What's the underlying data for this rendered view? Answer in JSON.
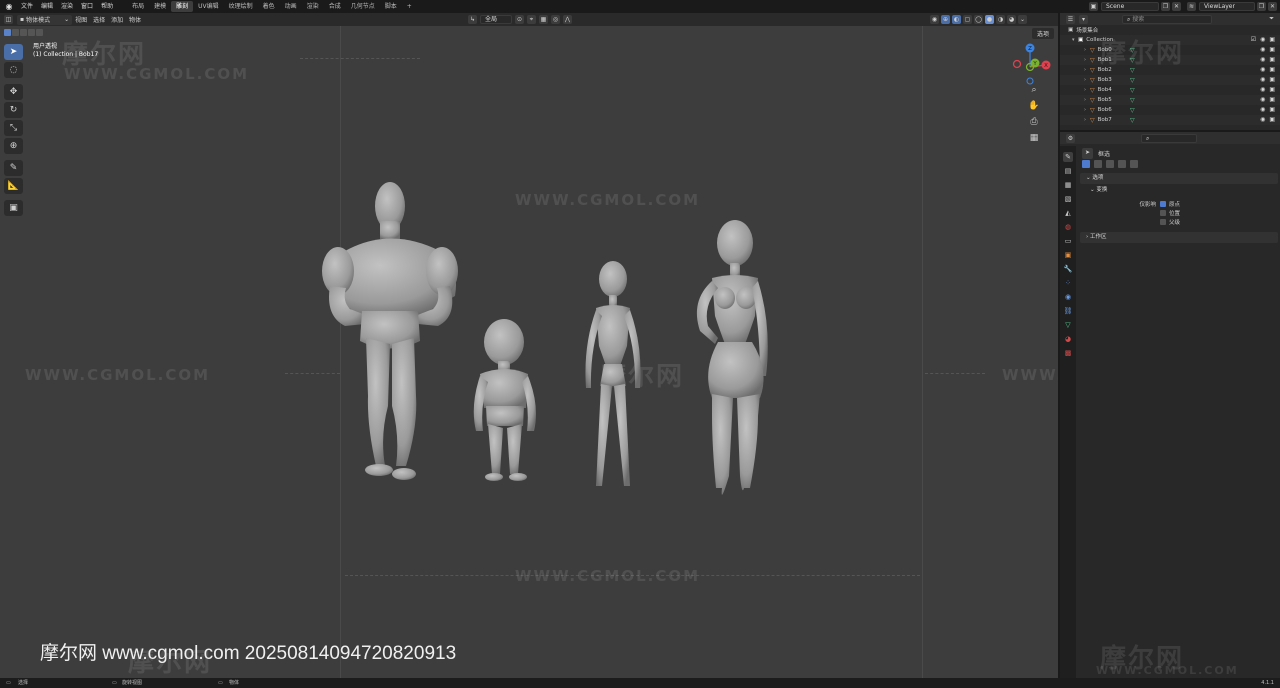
{
  "topbar": {
    "menus": [
      "文件",
      "编辑",
      "渲染",
      "窗口",
      "帮助"
    ],
    "workspaces": [
      "布局",
      "建模",
      "雕刻",
      "UV编辑",
      "纹理绘制",
      "着色",
      "动画",
      "渲染",
      "合成",
      "几何节点",
      "脚本"
    ],
    "active_workspace_index": 2,
    "add_tab": "+",
    "scene_name": "Scene",
    "view_layer": "ViewLayer"
  },
  "viewport_header": {
    "mode": "物体模式",
    "menus": [
      "视图",
      "选择",
      "添加",
      "物体"
    ],
    "transform_orientation": "全局",
    "options_button": "选项"
  },
  "viewport": {
    "view_name": "用户透视",
    "view_context": "(1) Collection | Bob17",
    "caption": "摩尔网 www.cgmol.com 20250814094720820913"
  },
  "watermarks": {
    "logo_text": "摩尔网",
    "url_logo": "WWW.CGMOL.COM"
  },
  "gizmo": {
    "x": "X",
    "y": "Y",
    "z": "Z",
    "x_color": "#e0414f",
    "y_color": "#79b32f",
    "z_color": "#3c83e0"
  },
  "outliner": {
    "search_placeholder": "搜索",
    "root": "场景集合",
    "collection": "Collection",
    "objects": [
      "Bob0",
      "Bob1",
      "Bob2",
      "Bob3",
      "Bob4",
      "Bob5",
      "Bob6",
      "Bob7"
    ]
  },
  "properties": {
    "tool_name": "框选",
    "options_panel": "选项",
    "transform_panel": "变换",
    "affect_only_label": "仅影响",
    "affect_origins": "原点",
    "affect_locations": "位置",
    "affect_parents": "父级",
    "workspace_panel": "工作区"
  },
  "statusbar": {
    "select": "选择",
    "rotate_view": "旋转视图",
    "object": "物体",
    "version": "4.1.1"
  }
}
